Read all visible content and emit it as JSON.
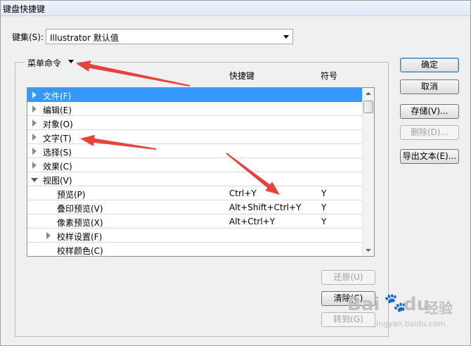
{
  "window": {
    "title": "键盘快捷键"
  },
  "keyset": {
    "label": "键集(S):",
    "value": "Illustrator 默认值"
  },
  "category": {
    "value": "菜单命令"
  },
  "columns": {
    "shortcut": "快捷键",
    "symbol": "符号"
  },
  "tree": {
    "rows": [
      {
        "label": "文件(F)",
        "shortcut": "",
        "symbol": "",
        "level": 0,
        "expander": "collapsed",
        "selected": true
      },
      {
        "label": "编辑(E)",
        "shortcut": "",
        "symbol": "",
        "level": 0,
        "expander": "collapsed",
        "selected": false
      },
      {
        "label": "对象(O)",
        "shortcut": "",
        "symbol": "",
        "level": 0,
        "expander": "collapsed",
        "selected": false
      },
      {
        "label": "文字(T)",
        "shortcut": "",
        "symbol": "",
        "level": 0,
        "expander": "collapsed",
        "selected": false
      },
      {
        "label": "选择(S)",
        "shortcut": "",
        "symbol": "",
        "level": 0,
        "expander": "collapsed",
        "selected": false
      },
      {
        "label": "效果(C)",
        "shortcut": "",
        "symbol": "",
        "level": 0,
        "expander": "collapsed",
        "selected": false
      },
      {
        "label": "视图(V)",
        "shortcut": "",
        "symbol": "",
        "level": 0,
        "expander": "expanded",
        "selected": false
      },
      {
        "label": "预览(P)",
        "shortcut": "Ctrl+Y",
        "symbol": "Y",
        "level": 1,
        "expander": "none",
        "selected": false
      },
      {
        "label": "叠印预览(V)",
        "shortcut": "Alt+Shift+Ctrl+Y",
        "symbol": "Y",
        "level": 1,
        "expander": "none",
        "selected": false
      },
      {
        "label": "像素预览(X)",
        "shortcut": "Alt+Ctrl+Y",
        "symbol": "Y",
        "level": 1,
        "expander": "none",
        "selected": false
      },
      {
        "label": "校样设置(F)",
        "shortcut": "",
        "symbol": "",
        "level": 1,
        "expander": "collapsed",
        "selected": false
      },
      {
        "label": "校样颜色(C)",
        "shortcut": "",
        "symbol": "",
        "level": 1,
        "expander": "none",
        "selected": false
      }
    ]
  },
  "buttons": {
    "ok": "确定",
    "cancel": "取消",
    "save": "存储(V)...",
    "delete": "删除(D)...",
    "export": "导出文本(E)...",
    "undo": "还原(U)",
    "clear": "清除(C)",
    "goto": "转到(G)"
  },
  "colors": {
    "selection": "#3399ff",
    "annotation": "#e8423c"
  },
  "watermark": {
    "brand": "Bai",
    "brand2": "du",
    "suffix": "经验",
    "url": "jingyan.baidu.com"
  }
}
